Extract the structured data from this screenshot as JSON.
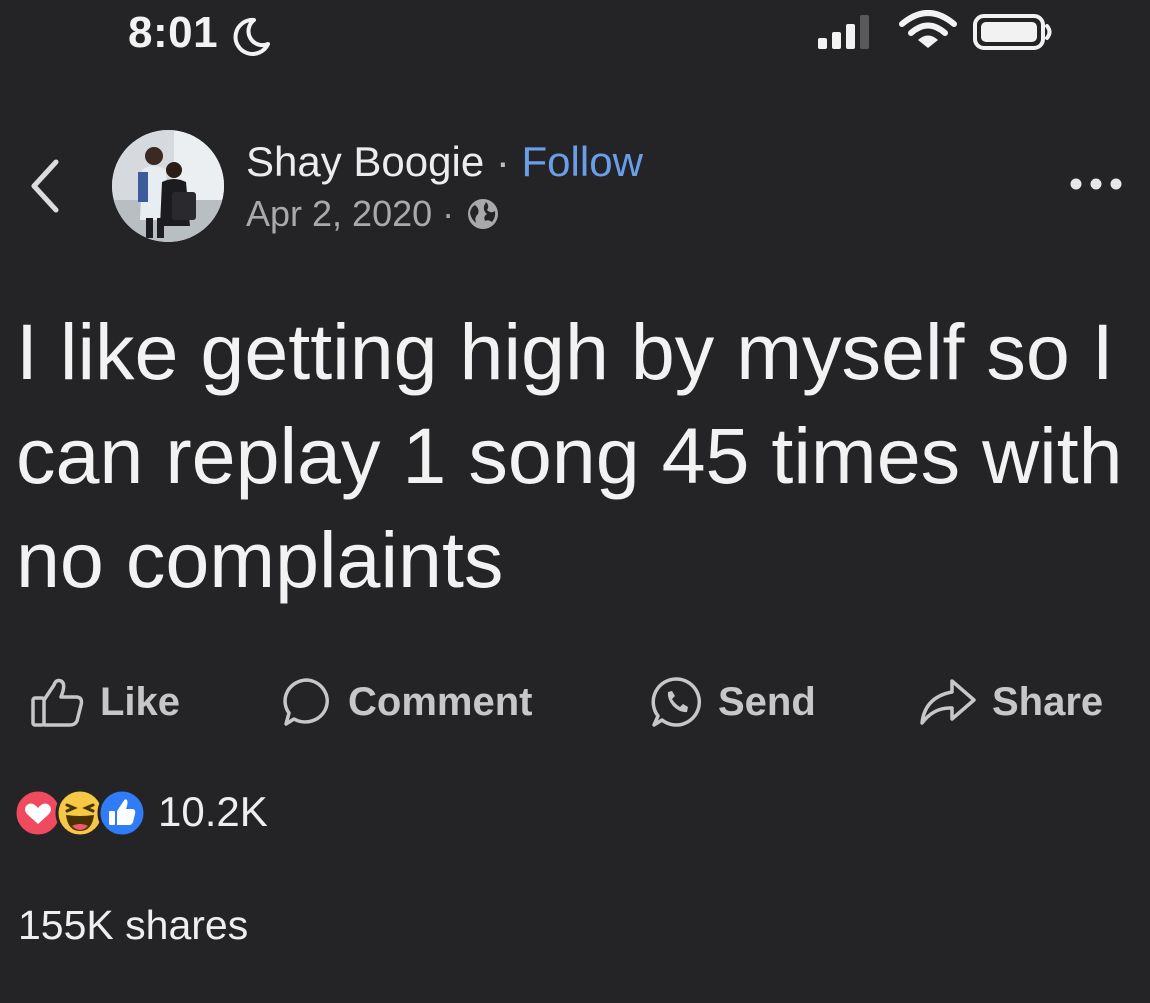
{
  "status_bar": {
    "time": "8:01",
    "icons": [
      "moon-icon",
      "signal-icon",
      "wifi-icon",
      "battery-icon"
    ]
  },
  "post": {
    "author": "Shay Boogie",
    "separator": "·",
    "follow_label": "Follow",
    "date": "Apr 2, 2020",
    "date_separator": "·",
    "audience_icon": "globe-icon",
    "text": "I like getting high by myself so I can replay 1 song 45 times with no complaints"
  },
  "actions": {
    "like_label": "Like",
    "comment_label": "Comment",
    "send_label": "Send",
    "share_label": "Share"
  },
  "reactions": {
    "icons": [
      "love-reaction-icon",
      "haha-reaction-icon",
      "like-reaction-icon"
    ],
    "count": "10.2K"
  },
  "shares": "155K shares",
  "colors": {
    "background": "#242426",
    "link": "#6b9ee8",
    "text": "#f2f2f2",
    "muted": "#a9a9ab"
  }
}
